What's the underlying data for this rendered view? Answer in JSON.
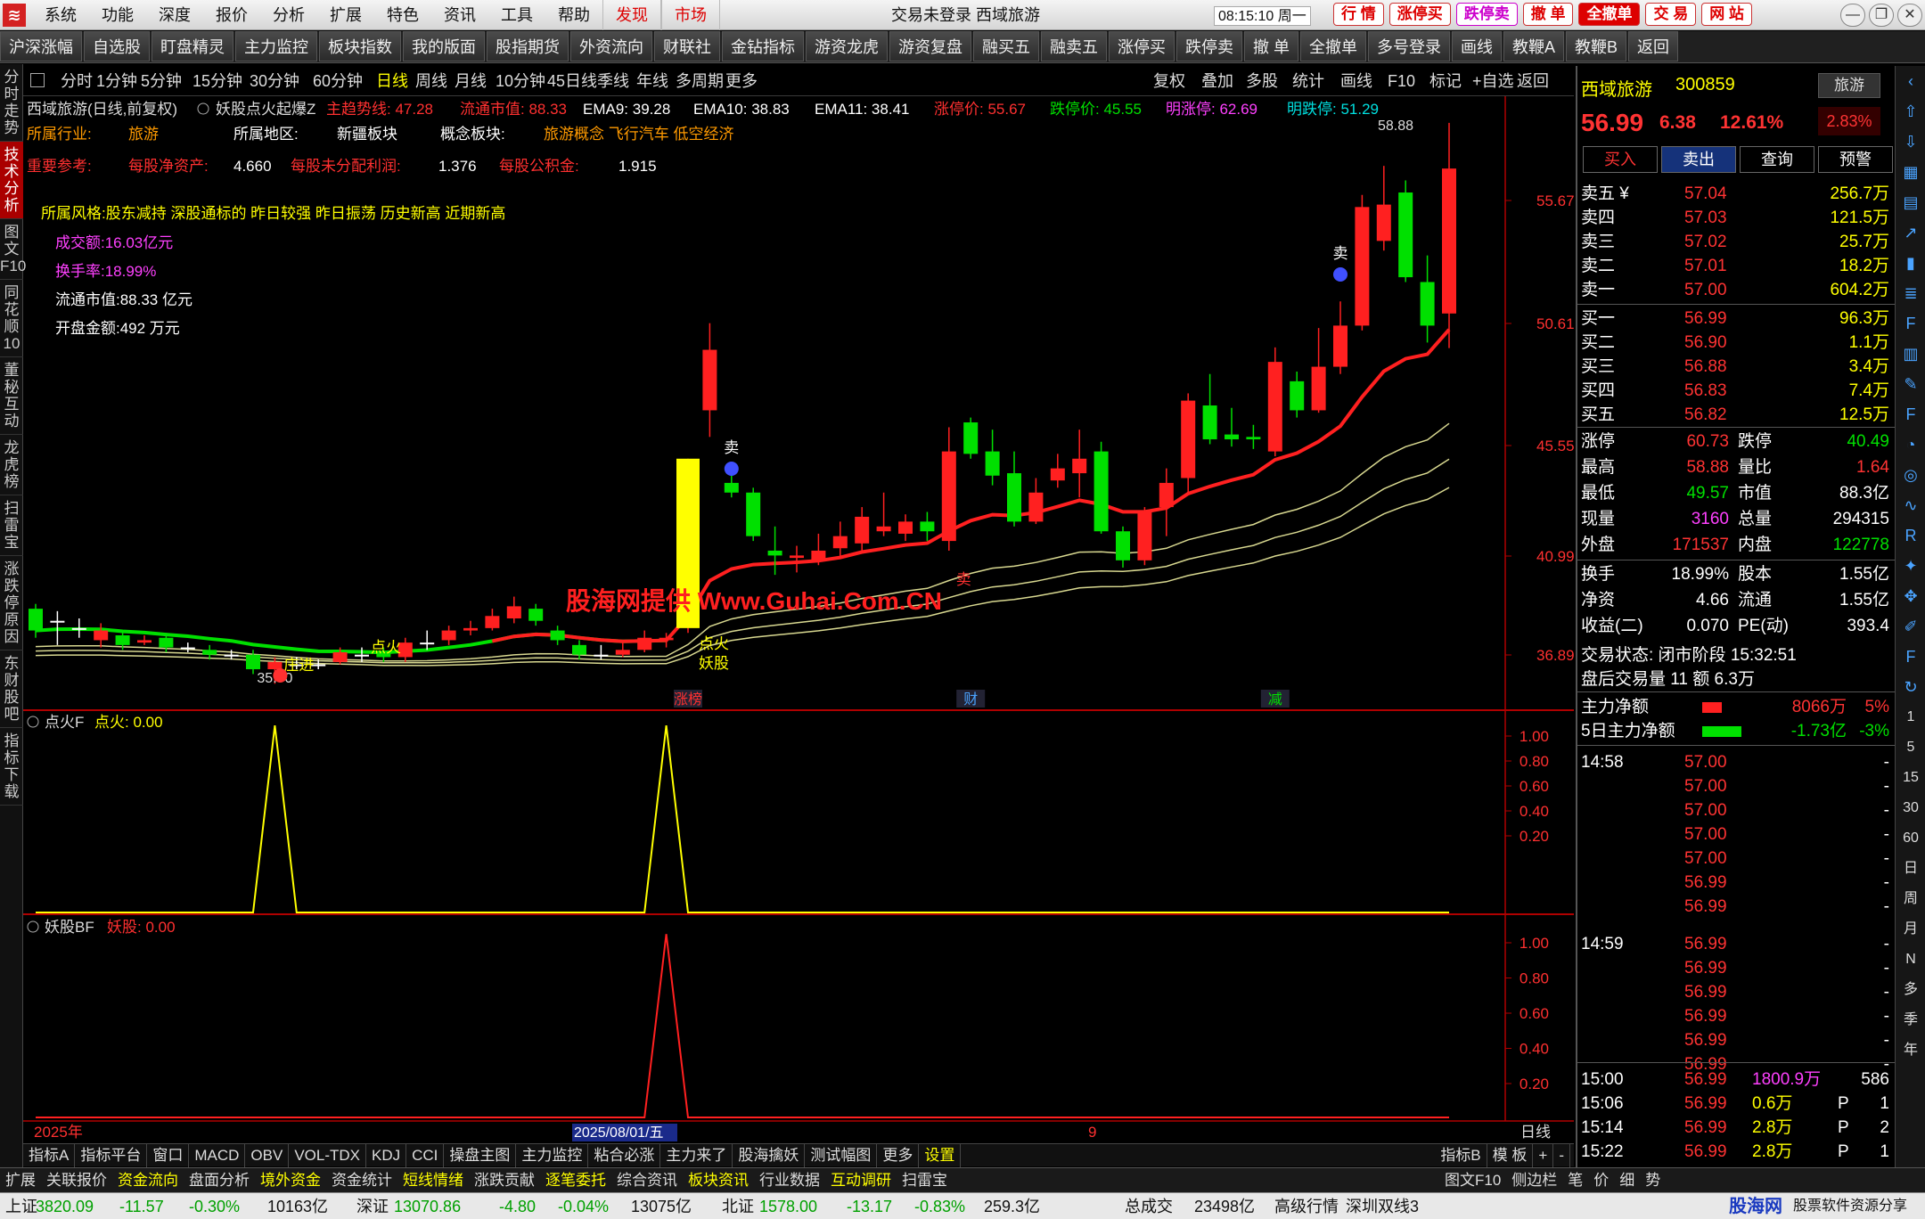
{
  "titlebar": {
    "menu": [
      "系统",
      "功能",
      "深度",
      "报价",
      "分析",
      "扩展",
      "特色",
      "资讯",
      "工具",
      "帮助",
      "发现",
      "市场"
    ],
    "center": "交易未登录  西域旅游",
    "clock": "08:15:10 周一",
    "quick": [
      "行 情",
      "涨停买",
      "跌停卖",
      "撤 单",
      "全撤单",
      "交 易",
      "网 站"
    ]
  },
  "toolbar": [
    "沪深涨幅",
    "自选股",
    "盯盘精灵",
    "主力监控",
    "板块指数",
    "我的版面",
    "股指期货",
    "外资流向",
    "财联社",
    "金钻指标",
    "游资龙虎",
    "游资复盘",
    "融买五",
    "融卖五",
    "涨停买",
    "跌停卖",
    "撤 单",
    "全撤单",
    "多号登录",
    "画线",
    "教鞭A",
    "教鞭B",
    "返回"
  ],
  "lefttabs": [
    "分时走势",
    "技术分析",
    "图文F10",
    "同花顺10",
    "董秘互动",
    "龙虎榜",
    "扫雷宝",
    "涨跌停原因",
    "东财股吧",
    "指标下载"
  ],
  "period": {
    "items": [
      "分时",
      "1分钟",
      "5分钟",
      "15分钟",
      "30分钟",
      "60分钟",
      "日线",
      "周线",
      "月线",
      "10分钟",
      "45日线",
      "季线",
      "年线",
      "多周期",
      "更多"
    ],
    "active": "日线",
    "right": [
      "复权",
      "叠加",
      "多股",
      "统计",
      "画线",
      "F10",
      "标记",
      "+自选",
      "返回"
    ]
  },
  "chart": {
    "header": {
      "name": "西域旅游(日线,前复权)",
      "indicator": "妖股点火起爆Z",
      "items": [
        {
          "label": "主趋势线: 47.28",
          "color": "#ff3030"
        },
        {
          "label": "流通市值: 88.33",
          "color": "#ff3030"
        },
        {
          "label": "EMA9: 39.28",
          "color": "#ffffff"
        },
        {
          "label": "EMA10: 38.83",
          "color": "#ffffff"
        },
        {
          "label": "EMA11: 38.41",
          "color": "#ffffff"
        },
        {
          "label": "涨停价: 55.67",
          "color": "#ff3030"
        },
        {
          "label": "跌停价: 45.55",
          "color": "#00e000"
        },
        {
          "label": "明涨停: 62.69",
          "color": "#ff40ff"
        },
        {
          "label": "明跌停: 51.29",
          "color": "#00e0e0"
        }
      ]
    },
    "info_line1": {
      "l1": "所属行业:",
      "v1": "旅游",
      "l2": "所属地区:",
      "v2": "新疆板块",
      "l3": "概念板块:",
      "v3": "旅游概念 飞行汽车 低空经济"
    },
    "info_line2": {
      "l1": "重要参考:",
      "l2": "每股净资产:",
      "v2": "4.660",
      "l3": "每股未分配利润:",
      "v3": "1.376",
      "l4": "每股公积金:",
      "v4": "1.915"
    },
    "style_line": "所属风格:股东减持 深股通标的 昨日较强 昨日振荡 历史新高 近期新高",
    "stats": [
      "成交额:16.03亿元",
      "换手率:18.99%",
      "流通市值:88.33 亿元",
      "开盘金额:492 万元"
    ],
    "watermark": "股海网提供 Www.Guhai.Com.CN",
    "high_label": "58.88",
    "low_label": "35.70",
    "price_ticks": [
      "55.67",
      "50.61",
      "45.55",
      "40.99",
      "36.89"
    ],
    "ind_ticks": [
      "1.00",
      "0.80",
      "0.60",
      "0.40",
      "0.20"
    ],
    "labels": {
      "dianhuo1": "点火",
      "dianhuo2": "点火",
      "zhuangjin": "庄进",
      "yaogu": "妖股",
      "sell1": "卖",
      "sell2": "卖",
      "sell3": "卖",
      "ztb": "涨榜",
      "cai": "财",
      "jian": "减"
    },
    "ind1": {
      "name": "点火F",
      "value": "点火: 0.00"
    },
    "ind2": {
      "name": "妖股BF",
      "value": "妖股: 0.00"
    },
    "xaxis": {
      "year": "2025年",
      "date": "2025/08/01/五",
      "nine": "9",
      "period": "日线"
    }
  },
  "chart_data": {
    "type": "candlestick",
    "candles": [
      {
        "o": 38.8,
        "c": 37.9,
        "h": 39.0,
        "l": 37.6
      },
      {
        "o": 38.3,
        "c": 38.3,
        "h": 38.7,
        "l": 37.3
      },
      {
        "o": 38.0,
        "c": 38.0,
        "h": 38.4,
        "l": 37.6
      },
      {
        "o": 37.5,
        "c": 37.9,
        "h": 38.2,
        "l": 37.2
      },
      {
        "o": 37.7,
        "c": 37.3,
        "h": 37.9,
        "l": 37.1
      },
      {
        "o": 37.4,
        "c": 37.5,
        "h": 37.7,
        "l": 37.3
      },
      {
        "o": 37.6,
        "c": 37.2,
        "h": 37.8,
        "l": 37.0
      },
      {
        "o": 37.2,
        "c": 37.2,
        "h": 37.4,
        "l": 37.0
      },
      {
        "o": 37.1,
        "c": 36.9,
        "h": 37.3,
        "l": 36.7
      },
      {
        "o": 36.9,
        "c": 36.9,
        "h": 37.1,
        "l": 36.7
      },
      {
        "o": 36.9,
        "c": 36.3,
        "h": 37.1,
        "l": 36.1
      },
      {
        "o": 36.3,
        "c": 36.6,
        "h": 36.8,
        "l": 35.7
      },
      {
        "o": 36.5,
        "c": 36.5,
        "h": 36.8,
        "l": 36.3
      },
      {
        "o": 36.5,
        "c": 36.5,
        "h": 36.7,
        "l": 36.3
      },
      {
        "o": 36.6,
        "c": 37.0,
        "h": 37.2,
        "l": 36.5
      },
      {
        "o": 36.9,
        "c": 36.9,
        "h": 37.2,
        "l": 36.6
      },
      {
        "o": 37.0,
        "c": 36.8,
        "h": 37.2,
        "l": 36.6
      },
      {
        "o": 36.8,
        "c": 37.4,
        "h": 37.6,
        "l": 36.6
      },
      {
        "o": 37.4,
        "c": 37.4,
        "h": 37.9,
        "l": 37.1
      },
      {
        "o": 37.5,
        "c": 37.9,
        "h": 38.1,
        "l": 37.3
      },
      {
        "o": 37.9,
        "c": 38.0,
        "h": 38.3,
        "l": 37.7
      },
      {
        "o": 38.0,
        "c": 38.5,
        "h": 38.8,
        "l": 37.9
      },
      {
        "o": 38.4,
        "c": 38.9,
        "h": 39.3,
        "l": 38.2
      },
      {
        "o": 38.8,
        "c": 38.3,
        "h": 39.0,
        "l": 38.1
      },
      {
        "o": 37.9,
        "c": 37.5,
        "h": 38.1,
        "l": 37.3
      },
      {
        "o": 37.3,
        "c": 36.9,
        "h": 37.5,
        "l": 36.7
      },
      {
        "o": 36.9,
        "c": 36.9,
        "h": 37.3,
        "l": 36.7
      },
      {
        "o": 36.9,
        "c": 37.1,
        "h": 37.4,
        "l": 36.8
      },
      {
        "o": 37.1,
        "c": 37.6,
        "h": 37.9,
        "l": 37.0
      },
      {
        "o": 37.5,
        "c": 37.6,
        "h": 37.8,
        "l": 37.2
      },
      {
        "o": 38.0,
        "c": 45.0,
        "h": 45.0,
        "l": 37.8
      },
      {
        "o": 47.0,
        "c": 49.5,
        "h": 50.6,
        "l": 45.9
      },
      {
        "o": 44.0,
        "c": 43.6,
        "h": 44.4,
        "l": 43.4
      },
      {
        "o": 43.6,
        "c": 41.8,
        "h": 43.8,
        "l": 41.6
      },
      {
        "o": 41.2,
        "c": 41.0,
        "h": 42.2,
        "l": 40.2
      },
      {
        "o": 40.9,
        "c": 41.0,
        "h": 41.4,
        "l": 40.3
      },
      {
        "o": 40.8,
        "c": 41.2,
        "h": 41.9,
        "l": 40.6
      },
      {
        "o": 41.3,
        "c": 41.8,
        "h": 42.4,
        "l": 40.9
      },
      {
        "o": 41.5,
        "c": 42.6,
        "h": 43.0,
        "l": 41.2
      },
      {
        "o": 42.0,
        "c": 42.2,
        "h": 43.6,
        "l": 41.8
      },
      {
        "o": 41.9,
        "c": 42.4,
        "h": 42.7,
        "l": 41.6
      },
      {
        "o": 42.4,
        "c": 42.0,
        "h": 42.8,
        "l": 41.6
      },
      {
        "o": 41.6,
        "c": 45.3,
        "h": 46.3,
        "l": 41.2
      },
      {
        "o": 46.5,
        "c": 45.2,
        "h": 46.7,
        "l": 45.0
      },
      {
        "o": 45.3,
        "c": 44.3,
        "h": 46.2,
        "l": 43.9
      },
      {
        "o": 44.4,
        "c": 42.4,
        "h": 45.3,
        "l": 42.2
      },
      {
        "o": 42.4,
        "c": 43.6,
        "h": 44.2,
        "l": 42.3
      },
      {
        "o": 44.1,
        "c": 44.6,
        "h": 45.2,
        "l": 43.8
      },
      {
        "o": 44.4,
        "c": 45.0,
        "h": 46.2,
        "l": 43.4
      },
      {
        "o": 45.3,
        "c": 42.0,
        "h": 45.7,
        "l": 41.9
      },
      {
        "o": 42.0,
        "c": 40.8,
        "h": 42.2,
        "l": 40.5
      },
      {
        "o": 40.8,
        "c": 42.8,
        "h": 43.0,
        "l": 40.6
      },
      {
        "o": 43.0,
        "c": 44.0,
        "h": 44.6,
        "l": 41.8
      },
      {
        "o": 44.2,
        "c": 47.4,
        "h": 47.7,
        "l": 43.6
      },
      {
        "o": 47.2,
        "c": 45.8,
        "h": 48.5,
        "l": 45.6
      },
      {
        "o": 46.0,
        "c": 45.8,
        "h": 47.1,
        "l": 45.5
      },
      {
        "o": 45.9,
        "c": 45.8,
        "h": 46.4,
        "l": 45.4
      },
      {
        "o": 45.3,
        "c": 49.0,
        "h": 49.6,
        "l": 45.1
      },
      {
        "o": 48.2,
        "c": 47.0,
        "h": 48.6,
        "l": 46.7
      },
      {
        "o": 47.0,
        "c": 48.8,
        "h": 50.4,
        "l": 46.9
      },
      {
        "o": 48.8,
        "c": 50.5,
        "h": 51.5,
        "l": 48.5
      },
      {
        "o": 50.5,
        "c": 55.4,
        "h": 55.9,
        "l": 50.3
      },
      {
        "o": 54.0,
        "c": 55.5,
        "h": 57.1,
        "l": 53.6
      },
      {
        "o": 56.0,
        "c": 52.5,
        "h": 56.5,
        "l": 52.3
      },
      {
        "o": 52.3,
        "c": 50.5,
        "h": 53.4,
        "l": 49.8
      },
      {
        "o": 51.0,
        "c": 56.99,
        "h": 58.88,
        "l": 49.57
      }
    ],
    "ind1_fires": [
      11,
      29
    ],
    "ind2_fires": [
      29
    ]
  },
  "rpanel": {
    "name": "西域旅游",
    "code": "300859",
    "tag": "旅游",
    "price": "56.99",
    "change": "6.38",
    "pct": "12.61%",
    "side_pct": "2.83%",
    "buttons": [
      "买入",
      "卖出",
      "查询",
      "预警"
    ],
    "asks": [
      [
        "卖五 ¥",
        "57.04",
        "256.7万"
      ],
      [
        "卖四",
        "57.03",
        "121.5万"
      ],
      [
        "卖三",
        "57.02",
        "25.7万"
      ],
      [
        "卖二",
        "57.01",
        "18.2万"
      ],
      [
        "卖一",
        "57.00",
        "604.2万"
      ]
    ],
    "bids": [
      [
        "买一",
        "56.99",
        "96.3万"
      ],
      [
        "买二",
        "56.90",
        "1.1万"
      ],
      [
        "买三",
        "56.88",
        "3.4万"
      ],
      [
        "买四",
        "56.83",
        "7.4万"
      ],
      [
        "买五",
        "56.82",
        "12.5万"
      ]
    ],
    "quote": [
      [
        "涨停",
        "60.73",
        "跌停",
        "40.49"
      ],
      [
        "最高",
        "58.88",
        "量比",
        "1.64"
      ],
      [
        "最低",
        "49.57",
        "市值",
        "88.3亿"
      ],
      [
        "现量",
        "3160",
        "总量",
        "294315"
      ],
      [
        "外盘",
        "171537",
        "内盘",
        "122778"
      ]
    ],
    "quote2": [
      [
        "换手",
        "18.99%",
        "股本",
        "1.55亿"
      ],
      [
        "净资",
        "4.66",
        "流通",
        "1.55亿"
      ],
      [
        "收益(二)",
        "0.070",
        "PE(动)",
        "393.4"
      ]
    ],
    "state": "交易状态: 闭市阶段 15:32:51",
    "after": "盘后交易量 11 额 6.3万",
    "flow1": [
      "主力净额",
      "8066万",
      "5%"
    ],
    "flow2": [
      "5日主力净额",
      "-1.73亿",
      "-3%"
    ],
    "ticks": [
      [
        "14:58",
        "57.00"
      ],
      [
        "",
        "57.00"
      ],
      [
        "",
        "57.00"
      ],
      [
        "",
        "57.00"
      ],
      [
        "",
        "57.00"
      ],
      [
        "",
        "56.99"
      ],
      [
        "",
        "56.99"
      ],
      [
        "14:59",
        "56.99"
      ],
      [
        "",
        "56.99"
      ],
      [
        "",
        "56.99"
      ],
      [
        "",
        "56.99"
      ],
      [
        "",
        "56.99"
      ],
      [
        "",
        "56.99"
      ]
    ],
    "trades": [
      [
        "15:00",
        "56.99",
        "1800.9万",
        "586"
      ],
      [
        "15:06",
        "56.99",
        "0.6万",
        "P",
        "1"
      ],
      [
        "15:14",
        "56.99",
        "2.8万",
        "P",
        "2"
      ],
      [
        "15:22",
        "56.99",
        "2.8万",
        "P",
        "1"
      ]
    ]
  },
  "indtabs": [
    "指标A",
    "指标平台",
    "窗口",
    "MACD",
    "OBV",
    "VOL-TDX",
    "KDJ",
    "CCI",
    "操盘主图",
    "主力监控",
    "粘合必涨",
    "主力来了",
    "股海擒妖",
    "测试幅图",
    "更多",
    "设置"
  ],
  "indtabs_right": [
    "指标B",
    "模 板",
    "+",
    "-"
  ],
  "navbar": [
    "扩展",
    "关联报价",
    "资金流向",
    "盘面分析",
    "境外资金",
    "资金统计",
    "短线情绪",
    "涨跌贡献",
    "逐笔委托",
    "综合资讯",
    "板块资讯",
    "行业数据",
    "互动调研",
    "扫雷宝"
  ],
  "navbar_right": [
    "图文F10",
    "侧边栏",
    "笔",
    "价",
    "细",
    "势"
  ],
  "status": {
    "sh": "上证",
    "sh_v": "3820.09",
    "sh_c": "-11.57",
    "sh_p": "-0.30%",
    "sh_a": "10163亿",
    "sz": "深证",
    "sz_v": "13070.86",
    "sz_c": "-4.80",
    "sz_p": "-0.04%",
    "sz_a": "13075亿",
    "bz": "北证",
    "bz_v": "1578.00",
    "bz_c": "-13.17",
    "bz_p": "-0.83%",
    "bz_a": "259.3亿",
    "total": "总成交",
    "total_v": "23498亿",
    "level": "高级行情",
    "conn": "深圳双线3",
    "brand": "股海网",
    "brand2": "股票软件资源分享",
    "site": "www.Guhai.Com.CN"
  }
}
